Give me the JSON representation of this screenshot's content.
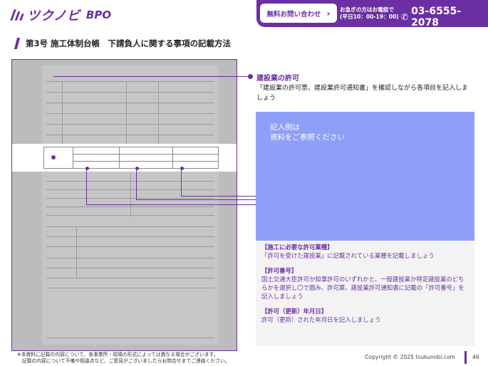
{
  "header": {
    "logo_text": "ツクノビ",
    "logo_sub": "BPO",
    "cta_label": "無料お問い合わせ",
    "tel_note_line1": "お急ぎの方はお電話で",
    "tel_note_line2": "(平日10：00-19：00)",
    "tel_number": "03-6555-2078",
    "accent_color": "#6b2fa3"
  },
  "page": {
    "title": "第3号 施工体制台帳　下請負人に関する事項の記載方法"
  },
  "annotation": {
    "title": "建設業の許可",
    "description": "「建設業の許可票、建設業許可通知書」を確認しながら各項目を記入しましょう"
  },
  "placeholder": {
    "line1": "記入例は",
    "line2": "資料をご参照ください",
    "color": "#8e9ff7"
  },
  "info": [
    {
      "title": "【施工に必要な許可業種】",
      "body": "「許可を受けた建設業」に記載されている業種を記載しましょう"
    },
    {
      "title": "【許可番号】",
      "body": "国土交通大臣許可か知事許可のいずれかと、一般建設業か特定建設業のどちらかを選択し〇で囲み、許可票、建設業許可通知書に記載の「許可番号」を記入しましょう"
    },
    {
      "title": "【許可（更新）年月日】",
      "body": "許可（更新）された年月日を記入しましょう"
    }
  ],
  "footer": {
    "footnote_line1": "※本資料に記載の内容について、各事業所・現場の形式によっては異なる場合がございます。",
    "footnote_line2": "　記載の内容について不備や相違点など、ご意見がございましたらお問合せまでご連絡ください。",
    "copyright": "Copyright © 2025 tsukunobi.com",
    "page_number": "46"
  }
}
